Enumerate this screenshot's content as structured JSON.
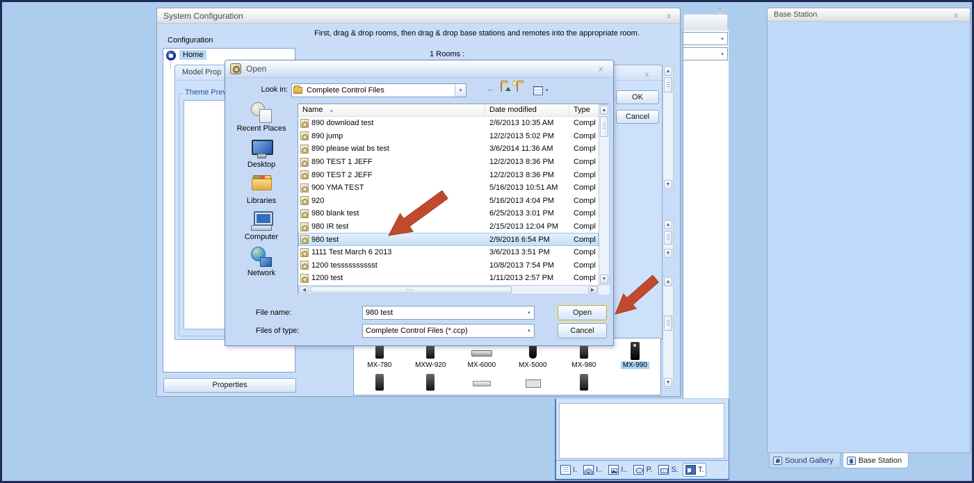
{
  "glyphs": {
    "close": "x",
    "dropdown": "▾",
    "sort_asc": "▲",
    "up": "▲",
    "down": "▼",
    "left": "◀",
    "right": "▶",
    "back": "←"
  },
  "colors": {
    "arrow_red": "#c04a2e",
    "selection_blue": "#c4ddf4",
    "accent_blue": "#2e5ea6"
  },
  "sys_window": {
    "title": "System Configuration",
    "configuration_label": "Configuration",
    "instruction": "First, drag & drop rooms, then drag & drop base stations and remotes into the appropriate room.",
    "home_item": "Home",
    "rooms_label": "1 Rooms :",
    "properties_button": "Properties",
    "model_properties": {
      "title": "Model Prop",
      "theme_preview_label": "Theme Prev",
      "ok_button": "OK",
      "cancel_button": "Cancel"
    },
    "remote_gallery": {
      "items": [
        {
          "label": "MX-780",
          "icon": "remote-slim"
        },
        {
          "label": "MXW-920",
          "icon": "remote-slim"
        },
        {
          "label": "MX-6000",
          "icon": "remote-flat"
        },
        {
          "label": "MX-5000",
          "icon": "remote-oval"
        },
        {
          "label": "MX-980",
          "icon": "remote-slim"
        },
        {
          "label": "MX-990",
          "icon": "remote-tall",
          "selected": true
        }
      ],
      "partial_row": [
        {
          "icon": "remote-slim"
        },
        {
          "icon": "remote-slim"
        },
        {
          "icon": "device-flat"
        },
        {
          "icon": "device-panel"
        },
        {
          "icon": "remote-slim"
        }
      ]
    }
  },
  "open_dialog": {
    "title": "Open",
    "look_in_label": "Look in:",
    "look_in_value": "Complete Control Files",
    "places": [
      {
        "label": "Recent Places",
        "icon": "recent-places-icon"
      },
      {
        "label": "Desktop",
        "icon": "desktop-icon"
      },
      {
        "label": "Libraries",
        "icon": "libraries-icon"
      },
      {
        "label": "Computer",
        "icon": "computer-icon"
      },
      {
        "label": "Network",
        "icon": "network-icon"
      }
    ],
    "file_list": {
      "columns": {
        "name": "Name",
        "date": "Date modified",
        "type": "Type"
      },
      "rows": [
        {
          "name": "890 download test",
          "date": "2/6/2013 10:35 AM",
          "type": "Compl"
        },
        {
          "name": "890 jump",
          "date": "12/2/2013 5:02 PM",
          "type": "Compl"
        },
        {
          "name": "890 please wiat bs test",
          "date": "3/6/2014 11:36 AM",
          "type": "Compl"
        },
        {
          "name": "890 TEST 1 JEFF",
          "date": "12/2/2013 8:36 PM",
          "type": "Compl"
        },
        {
          "name": "890 TEST 2 JEFF",
          "date": "12/2/2013 8:36 PM",
          "type": "Compl"
        },
        {
          "name": "900 YMA TEST",
          "date": "5/16/2013 10:51 AM",
          "type": "Compl"
        },
        {
          "name": "920",
          "date": "5/16/2013 4:04 PM",
          "type": "Compl"
        },
        {
          "name": "980 blank test",
          "date": "6/25/2013 3:01 PM",
          "type": "Compl"
        },
        {
          "name": "980 IR test",
          "date": "2/15/2013 12:04 PM",
          "type": "Compl"
        },
        {
          "name": "980 test",
          "date": "2/9/2016 6:54 PM",
          "type": "Compl",
          "selected": true
        },
        {
          "name": "1111 Test March 6 2013",
          "date": "3/6/2013 3:51 PM",
          "type": "Compl"
        },
        {
          "name": "1200 tesssssssssst",
          "date": "10/8/2013 7:54 PM",
          "type": "Compl"
        },
        {
          "name": "1200 test",
          "date": "1/11/2013 2:57 PM",
          "type": "Compl"
        }
      ]
    },
    "file_name_label": "File name:",
    "file_name_value": "980 test",
    "files_of_type_label": "Files of type:",
    "files_of_type_value": "Complete Control Files (*.ccp)",
    "open_button": "Open",
    "cancel_button": "Cancel"
  },
  "right_panel": {
    "title": "Base Station",
    "tabs": [
      {
        "label": "Sound Gallery",
        "icon": "sound-gallery-icon"
      },
      {
        "label": "Base Station",
        "icon": "base-station-icon",
        "selected": true
      }
    ]
  },
  "bottom_tab_bar": {
    "tabs": [
      {
        "label": "I.",
        "icon": "list-grid-icon"
      },
      {
        "label": "I..",
        "icon": "antenna-icon"
      },
      {
        "label": "I..",
        "icon": "ip-device-icon"
      },
      {
        "label": "P.",
        "icon": "pronto-icon"
      },
      {
        "label": "S.",
        "icon": "sound-icon"
      },
      {
        "label": "T.",
        "icon": "transfer-icon",
        "selected": true
      }
    ]
  }
}
